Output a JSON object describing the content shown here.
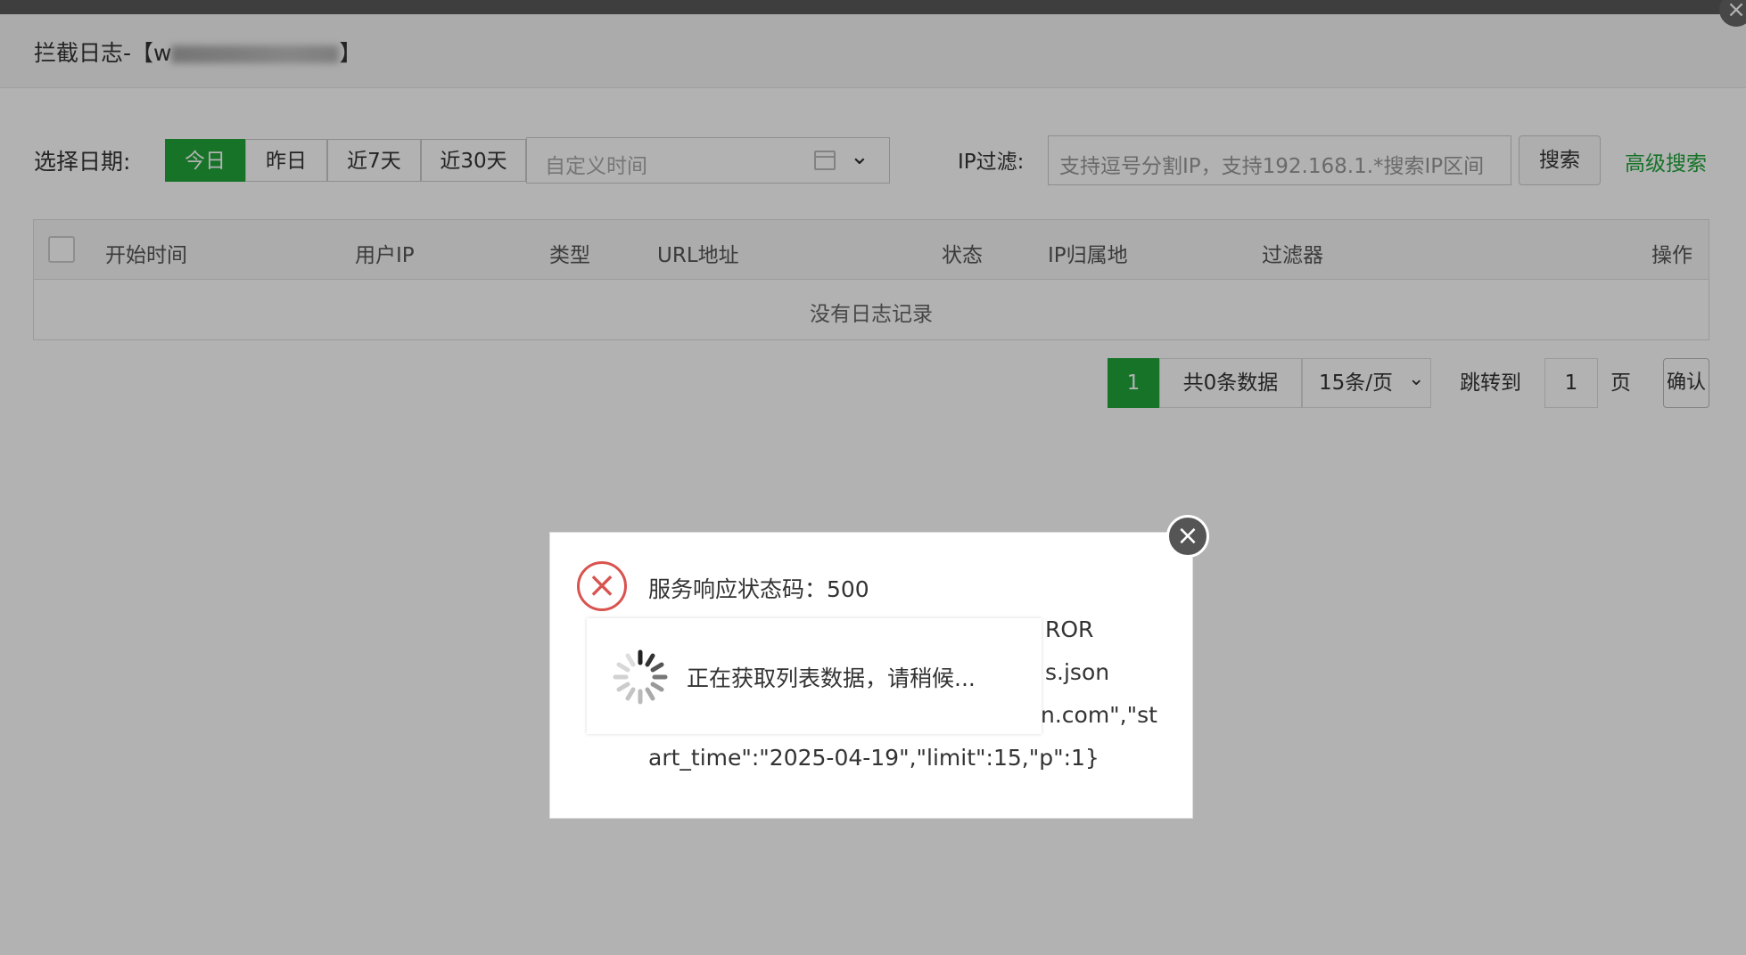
{
  "window": {
    "title": "拦截日志-【www.2wesm.com】",
    "title_prefix": "拦截日志-【",
    "title_masked": "w",
    "title_suffix": "】"
  },
  "filter": {
    "date_label": "选择日期:",
    "date_options": [
      "今日",
      "昨日",
      "近7天",
      "近30天"
    ],
    "date_active": "今日",
    "custom_time_placeholder": "自定义时间",
    "ip_label": "IP过滤:",
    "ip_placeholder": "支持逗号分割IP，支持192.168.1.*搜索IP区间",
    "search_button": "搜索",
    "advanced_search": "高级搜索"
  },
  "table": {
    "columns": [
      "开始时间",
      "用户IP",
      "类型",
      "URL地址",
      "状态",
      "IP归属地",
      "过滤器",
      "操作"
    ],
    "empty_text": "没有日志记录"
  },
  "pagination": {
    "current_page": "1",
    "total_text": "共0条数据",
    "page_size": "15条/页",
    "jump_label": "跳转到",
    "jump_value": "1",
    "page_unit": "页",
    "confirm": "确认"
  },
  "error_dialog": {
    "status_line": "服务响应状态码：500",
    "line2": "ROR",
    "line3": "s.json",
    "line4": "n.com\",\"st",
    "line5": "art_time\":\"2025-04-19\",\"limit\":15,\"p\":1}"
  },
  "loading": {
    "text": "正在获取列表数据，请稍候..."
  },
  "colors": {
    "accent": "#20a53a",
    "error": "#d9534f"
  }
}
